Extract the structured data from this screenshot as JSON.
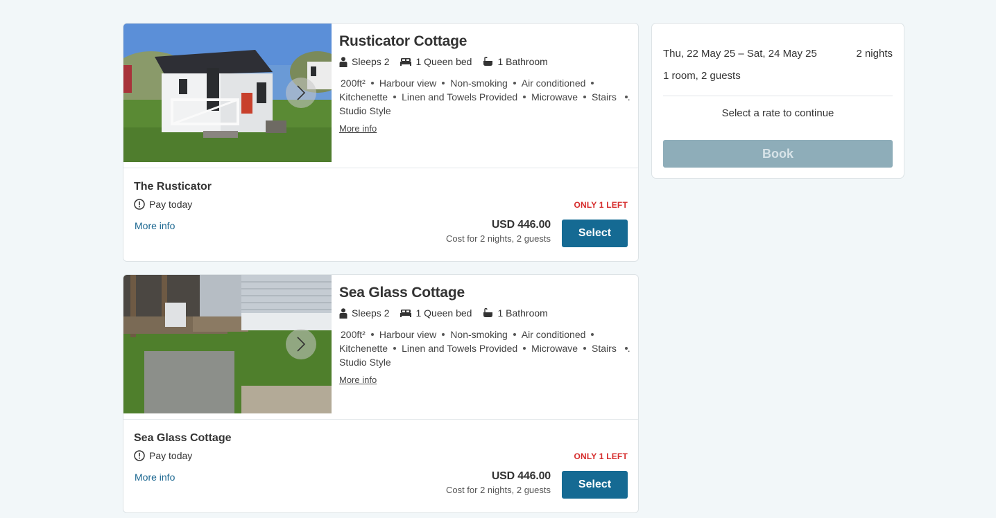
{
  "rooms": [
    {
      "name": "Rusticator Cottage",
      "sleeps": "Sleeps 2",
      "bed": "1 Queen bed",
      "bath": "1 Bathroom",
      "amenities_row1": [
        "200ft²",
        "Harbour view",
        "Non-smoking",
        "Air conditioned"
      ],
      "amenities_row2": [
        "Kitchenette",
        "Linen and Towels Provided",
        "Microwave",
        "Stairs"
      ],
      "amenities_row2_overflow": "...",
      "amenities_row3": "Studio Style",
      "more_info": "More info",
      "rate": {
        "name": "The Rusticator",
        "pay": "Pay today",
        "more_info": "More info",
        "availability": "ONLY 1 LEFT",
        "price": "USD 446.00",
        "price_note": "Cost for 2 nights, 2 guests",
        "select_label": "Select"
      }
    },
    {
      "name": "Sea Glass Cottage",
      "sleeps": "Sleeps 2",
      "bed": "1 Queen bed",
      "bath": "1 Bathroom",
      "amenities_row1": [
        "200ft²",
        "Harbour view",
        "Non-smoking",
        "Air conditioned"
      ],
      "amenities_row2": [
        "Kitchenette",
        "Linen and Towels Provided",
        "Microwave",
        "Stairs"
      ],
      "amenities_row2_overflow": "...",
      "amenities_row3": "Studio Style",
      "more_info": "More info",
      "rate": {
        "name": "Sea Glass Cottage",
        "pay": "Pay today",
        "more_info": "More info",
        "availability": "ONLY 1 LEFT",
        "price": "USD 446.00",
        "price_note": "Cost for 2 nights, 2 guests",
        "select_label": "Select"
      }
    }
  ],
  "summary": {
    "dates": "Thu, 22 May 25 – Sat, 24 May 25",
    "nights": "2 nights",
    "guests": "1 room, 2 guests",
    "cta": "Select a rate to continue",
    "book_label": "Book"
  },
  "colors": {
    "primary": "#156a93",
    "alert": "#d62d2d",
    "link": "#1a6690",
    "book_disabled": "#8eadb9",
    "background": "#f2f7f9"
  }
}
